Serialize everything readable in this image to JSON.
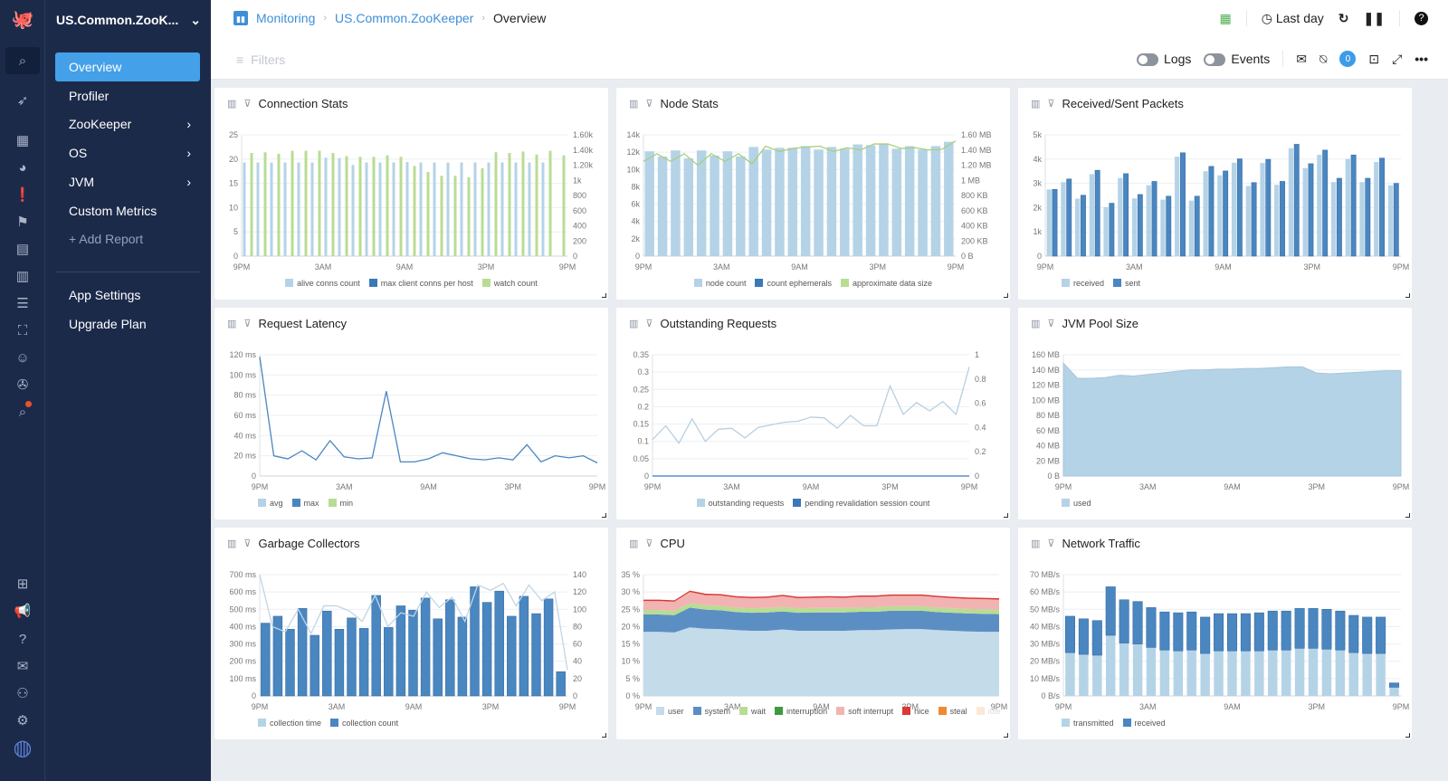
{
  "app": {
    "project": "US.Common.ZooK...",
    "filters_placeholder": "Filters"
  },
  "breadcrumb": [
    {
      "label": "Monitoring"
    },
    {
      "label": "US.Common.ZooKeeper"
    },
    {
      "label": "Overview"
    }
  ],
  "toolbar": {
    "time_range": "Last day",
    "logs_label": "Logs",
    "events_label": "Events",
    "notification_count": "0"
  },
  "rail_icons": [
    "logo-octopus-icon",
    "search-icon",
    "rocket-icon",
    "grid-icon",
    "dashboard-gauge-icon",
    "alert-icon",
    "flag-icon",
    "inbox-icon",
    "bar-chart-icon",
    "document-icon",
    "scan-user-icon",
    "robot-icon",
    "film-reel-icon",
    "report-search-icon",
    "gift-icon",
    "megaphone-icon",
    "help-icon",
    "mail-icon",
    "team-icon",
    "settings-icon",
    "avatar"
  ],
  "sidebar": {
    "items": [
      {
        "label": "Overview",
        "active": true
      },
      {
        "label": "Profiler"
      },
      {
        "label": "ZooKeeper",
        "chevron": true
      },
      {
        "label": "OS",
        "chevron": true
      },
      {
        "label": "JVM",
        "chevron": true
      },
      {
        "label": "Custom Metrics"
      },
      {
        "label": "+ Add Report"
      }
    ],
    "bottom": [
      {
        "label": "App Settings"
      },
      {
        "label": "Upgrade Plan"
      }
    ]
  },
  "colors": {
    "light": "#b5d3e7",
    "dark": "#4a86c0",
    "green": "#b9dc94",
    "red": "#d93a34",
    "pink": "#f0a3a3",
    "grid": "#eceff2"
  },
  "chart_data": [
    {
      "id": "conn",
      "title": "Connection Stats",
      "type": "bar",
      "x_ticks": [
        "9PM",
        "3AM",
        "9AM",
        "3PM",
        "9PM"
      ],
      "y_ticks": [
        "0",
        "5",
        "10",
        "15",
        "20",
        "25"
      ],
      "y2_ticks": [
        "0",
        "200",
        "400",
        "600",
        "800",
        "1k",
        "1.20k",
        "1.40k",
        "1.60k"
      ],
      "ylim": [
        0,
        25
      ],
      "y2lim": [
        0,
        1600
      ],
      "series": [
        {
          "name": "alive conns count",
          "color": "#b5d3e7",
          "axis": "left",
          "values": [
            19.3,
            19.3,
            19.3,
            19.3,
            19.3,
            19.3,
            20.3,
            20.2,
            18.8,
            19.3,
            19.3,
            19.3,
            19.4,
            19.3,
            19.3,
            19.3,
            19.3,
            19.3,
            19.3,
            19.3,
            19.3,
            19.3,
            19.3
          ]
        },
        {
          "name": "max client conns per host",
          "color": "#3a78b8",
          "axis": "left",
          "values": [
            0,
            0,
            0,
            0,
            0,
            0,
            0,
            0,
            0,
            0,
            0,
            0,
            0,
            0,
            0,
            0,
            0,
            0,
            0,
            0,
            0,
            0,
            0
          ]
        },
        {
          "name": "watch count",
          "color": "#b9dc94",
          "axis": "right",
          "values": [
            1360,
            1370,
            1350,
            1390,
            1390,
            1390,
            1360,
            1320,
            1310,
            1310,
            1330,
            1310,
            1190,
            1110,
            1060,
            1060,
            1040,
            1160,
            1370,
            1360,
            1380,
            1340,
            1390,
            1330
          ]
        }
      ]
    },
    {
      "id": "node",
      "title": "Node Stats",
      "type": "bar",
      "x_ticks": [
        "9PM",
        "3AM",
        "9AM",
        "3PM",
        "9PM"
      ],
      "y_ticks": [
        "0",
        "2k",
        "4k",
        "6k",
        "8k",
        "10k",
        "12k",
        "14k"
      ],
      "y2_ticks": [
        "0 B",
        "200 KB",
        "400 KB",
        "600 KB",
        "800 KB",
        "1 MB",
        "1.20 MB",
        "1.40 MB",
        "1.60 MB"
      ],
      "ylim": [
        0,
        14000
      ],
      "y2lim": [
        0,
        1.6
      ],
      "series": [
        {
          "name": "node count",
          "color": "#b5d3e7",
          "axis": "left",
          "values": [
            12100,
            11500,
            12200,
            11300,
            12200,
            11600,
            12100,
            11500,
            12600,
            12300,
            12500,
            12500,
            12700,
            12300,
            12600,
            12400,
            12900,
            12800,
            13000,
            12400,
            12700,
            12300,
            12700,
            13200
          ]
        },
        {
          "name": "count ephemerals",
          "color": "#3a78b8",
          "axis": "left",
          "values": []
        },
        {
          "name": "approximate data size",
          "color": "#b9dc94",
          "axis": "right",
          "line": true,
          "values": [
            1.25,
            1.35,
            1.25,
            1.35,
            1.2,
            1.35,
            1.25,
            1.35,
            1.22,
            1.45,
            1.38,
            1.42,
            1.44,
            1.45,
            1.38,
            1.43,
            1.4,
            1.48,
            1.48,
            1.42,
            1.43,
            1.4,
            1.41,
            1.52
          ]
        }
      ]
    },
    {
      "id": "pkts",
      "title": "Received/Sent Packets",
      "type": "bar",
      "x_ticks": [
        "9PM",
        "3AM",
        "9AM",
        "3PM",
        "9PM"
      ],
      "y_ticks": [
        "0",
        "1k",
        "2k",
        "3k",
        "4k",
        "5k"
      ],
      "ylim": [
        0,
        5000
      ],
      "series": [
        {
          "name": "received",
          "color": "#b5d3e7",
          "values": [
            2750,
            3050,
            2370,
            3380,
            2020,
            3220,
            2380,
            2920,
            2330,
            4100,
            2290,
            3500,
            3330,
            3850,
            2890,
            3840,
            2940,
            4450,
            3630,
            4180,
            3050,
            4010,
            3050,
            3880,
            2920
          ]
        },
        {
          "name": "sent",
          "color": "#4a86c0",
          "values": [
            2750,
            3180,
            2510,
            3540,
            2180,
            3400,
            2540,
            3080,
            2470,
            4260,
            2470,
            3700,
            3510,
            4010,
            3030,
            3990,
            3080,
            4610,
            3810,
            4370,
            3210,
            4170,
            3210,
            4040,
            3000
          ]
        }
      ]
    },
    {
      "id": "lat",
      "title": "Request Latency",
      "type": "line",
      "x_ticks": [
        "9PM",
        "3AM",
        "9AM",
        "3PM",
        "9PM"
      ],
      "y_ticks": [
        "0",
        "20 ms",
        "40 ms",
        "60 ms",
        "80 ms",
        "100 ms",
        "120 ms"
      ],
      "ylim": [
        0,
        120
      ],
      "series": [
        {
          "name": "avg",
          "color": "#b5d3e7",
          "values": []
        },
        {
          "name": "max",
          "color": "#4a86c0",
          "values": [
            118,
            20,
            17,
            25,
            16,
            35,
            19,
            17,
            18,
            84,
            14,
            14,
            17,
            23,
            20,
            17,
            16,
            18,
            16,
            31,
            14,
            20,
            18,
            20,
            13
          ]
        },
        {
          "name": "min",
          "color": "#b9dc94",
          "values": []
        }
      ]
    },
    {
      "id": "out",
      "title": "Outstanding Requests",
      "type": "line",
      "x_ticks": [
        "9PM",
        "3AM",
        "9AM",
        "3PM",
        "9PM"
      ],
      "y_ticks": [
        "0",
        "0.05",
        "0.1",
        "0.15",
        "0.2",
        "0.25",
        "0.3",
        "0.35"
      ],
      "y2_ticks": [
        "0",
        "0.2",
        "0.4",
        "0.6",
        "0.8",
        "1"
      ],
      "ylim": [
        0,
        0.35
      ],
      "y2lim": [
        0,
        1
      ],
      "series": [
        {
          "name": "outstanding requests",
          "color": "#b5d3e7",
          "values": [
            0.105,
            0.145,
            0.095,
            0.165,
            0.1,
            0.135,
            0.138,
            0.11,
            0.14,
            0.148,
            0.155,
            0.158,
            0.17,
            0.168,
            0.138,
            0.175,
            0.145,
            0.145,
            0.26,
            0.178,
            0.212,
            0.188,
            0.215,
            0.178,
            0.315
          ]
        },
        {
          "name": "pending revalidation session count",
          "color": "#3a78b8",
          "values": [
            0,
            0,
            0,
            0,
            0,
            0,
            0,
            0,
            0,
            0,
            0,
            0,
            0,
            0,
            0,
            0,
            0,
            0,
            0,
            0,
            0,
            0,
            0,
            0,
            0
          ]
        }
      ]
    },
    {
      "id": "jvm",
      "title": "JVM Pool Size",
      "type": "area",
      "x_ticks": [
        "9PM",
        "3AM",
        "9AM",
        "3PM",
        "9PM"
      ],
      "y_ticks": [
        "0 B",
        "20 MB",
        "40 MB",
        "60 MB",
        "80 MB",
        "100 MB",
        "120 MB",
        "140 MB",
        "160 MB"
      ],
      "ylim": [
        0,
        160
      ],
      "series": [
        {
          "name": "used",
          "color": "#b5d3e7",
          "values": [
            149,
            129,
            129,
            130,
            133,
            132,
            134,
            136,
            138,
            140,
            140,
            141,
            141,
            142,
            142,
            143,
            144,
            144,
            136,
            135,
            136,
            137,
            138,
            139,
            139
          ]
        }
      ]
    },
    {
      "id": "gc",
      "title": "Garbage Collectors",
      "type": "bar",
      "x_ticks": [
        "9PM",
        "3AM",
        "9AM",
        "3PM",
        "9PM"
      ],
      "y_ticks": [
        "0",
        "100 ms",
        "200 ms",
        "300 ms",
        "400 ms",
        "500 ms",
        "600 ms",
        "700 ms"
      ],
      "y2_ticks": [
        "0",
        "20",
        "40",
        "60",
        "80",
        "100",
        "120",
        "140"
      ],
      "ylim": [
        0,
        700
      ],
      "y2lim": [
        0,
        140
      ],
      "series": [
        {
          "name": "collection time",
          "color": "#b5d3e7",
          "axis": "left",
          "line": true,
          "values": [
            700,
            400,
            370,
            500,
            360,
            520,
            520,
            490,
            430,
            580,
            400,
            480,
            460,
            600,
            510,
            570,
            430,
            640,
            610,
            650,
            520,
            640,
            550,
            600,
            150
          ]
        },
        {
          "name": "collection count",
          "color": "#4a86c0",
          "axis": "right",
          "values": [
            84,
            92,
            77,
            101,
            70,
            98,
            77,
            90,
            78,
            116,
            79,
            104,
            99,
            113,
            89,
            111,
            91,
            126,
            108,
            121,
            92,
            115,
            95,
            112,
            28
          ]
        }
      ]
    },
    {
      "id": "cpu",
      "title": "CPU",
      "type": "area",
      "x_ticks": [
        "9PM",
        "3AM",
        "9AM",
        "3PM",
        "9PM"
      ],
      "y_ticks": [
        "0 %",
        "5 %",
        "10 %",
        "15 %",
        "20 %",
        "25 %",
        "30 %",
        "35 %"
      ],
      "ylim": [
        0,
        35
      ],
      "series": [
        {
          "name": "user",
          "color": "#c4dbea",
          "values": [
            18.5,
            18.5,
            18.3,
            19.8,
            19.4,
            19.3,
            19,
            18.8,
            18.8,
            19.2,
            18.8,
            18.8,
            18.8,
            18.8,
            19,
            19,
            19.2,
            19.3,
            19.3,
            19,
            18.8,
            18.6,
            18.5,
            18.5
          ]
        },
        {
          "name": "system",
          "color": "#5b8fc4",
          "values": [
            5,
            5,
            5,
            5.7,
            5.5,
            5.4,
            5.2,
            5.2,
            5.3,
            5.2,
            5.2,
            5.3,
            5.3,
            5.3,
            5.3,
            5.3,
            5.4,
            5.3,
            5.3,
            5.2,
            5.2,
            5.2,
            5.2,
            5.1
          ]
        },
        {
          "name": "wait",
          "color": "#b9dc94",
          "values": [
            1.3,
            1.3,
            1.3,
            1.3,
            1.3,
            1.3,
            1.3,
            1.3,
            1.3,
            1.3,
            1.3,
            1.3,
            1.3,
            1.3,
            1.3,
            1.3,
            1.3,
            1.3,
            1.3,
            1.3,
            1.3,
            1.3,
            1.3,
            1.3
          ]
        },
        {
          "name": "interruption",
          "color": "#3e9a3e",
          "values": []
        },
        {
          "name": "soft interrupt",
          "color": "#f2b3b3",
          "values": [
            2.6,
            2.6,
            2.6,
            3.2,
            2.9,
            3,
            2.9,
            2.9,
            2.9,
            3.1,
            2.9,
            2.9,
            3,
            2.9,
            3,
            3,
            3,
            3,
            3,
            3,
            2.9,
            2.9,
            2.9,
            2.9
          ]
        },
        {
          "name": "nice",
          "color": "#d93a34",
          "values": [
            0.4,
            0.4,
            0.4,
            0.4,
            0.4,
            0.4,
            0.4,
            0.4,
            0.4,
            0.4,
            0.4,
            0.4,
            0.4,
            0.4,
            0.4,
            0.4,
            0.4,
            0.4,
            0.4,
            0.4,
            0.4,
            0.4,
            0.4,
            0.4
          ]
        },
        {
          "name": "steal",
          "color": "#f08a32",
          "values": []
        },
        {
          "name": "idle",
          "color": "#fbe9d6",
          "values": []
        }
      ]
    },
    {
      "id": "net",
      "title": "Network Traffic",
      "type": "stacked-bar",
      "x_ticks": [
        "9PM",
        "3AM",
        "9AM",
        "3PM",
        "9PM"
      ],
      "y_ticks": [
        "0 B/s",
        "10 MB/s",
        "20 MB/s",
        "30 MB/s",
        "40 MB/s",
        "50 MB/s",
        "60 MB/s",
        "70 MB/s"
      ],
      "ylim": [
        0,
        70
      ],
      "series": [
        {
          "name": "transmitted",
          "color": "#b5d3e7",
          "values": [
            25,
            24,
            23.5,
            35,
            30.5,
            30,
            28,
            26.5,
            26,
            26.5,
            24.5,
            26,
            26,
            26,
            26,
            26.5,
            26.5,
            27.5,
            27.5,
            27,
            26.5,
            25,
            24.5,
            24.5,
            5
          ]
        },
        {
          "name": "received",
          "color": "#4a86c0",
          "values": [
            21,
            20.5,
            20,
            28,
            25,
            24.5,
            23,
            22,
            22,
            22,
            21,
            21.5,
            21.5,
            21.5,
            22,
            22.5,
            22.5,
            23,
            23,
            23,
            22.5,
            21.5,
            21,
            21,
            2.5
          ]
        }
      ]
    }
  ]
}
